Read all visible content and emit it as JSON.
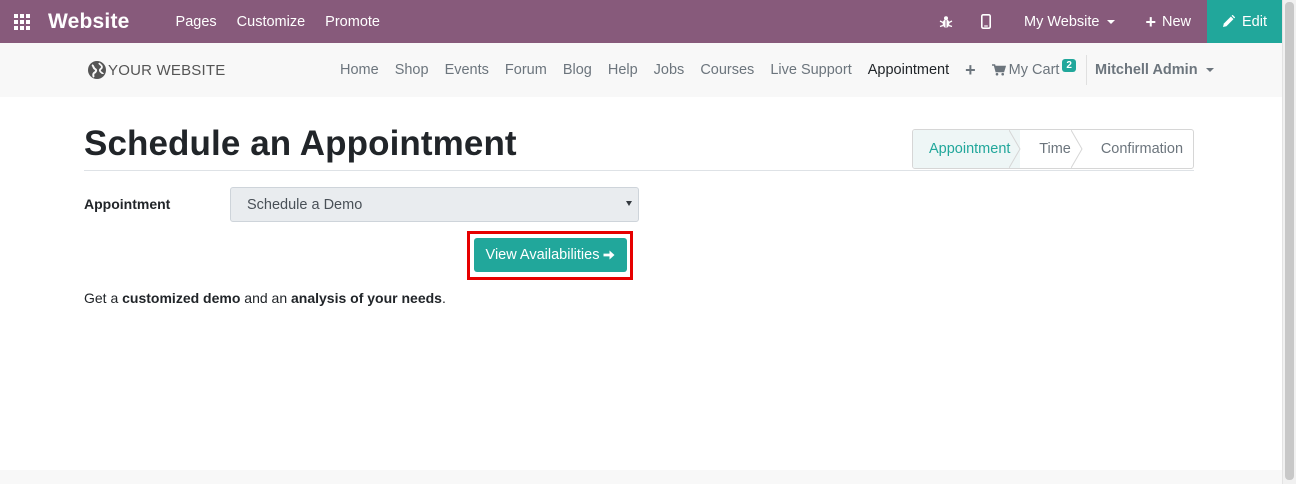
{
  "topbar": {
    "brand": "Website",
    "menu": [
      "Pages",
      "Customize",
      "Promote"
    ],
    "site_selector": "My Website",
    "new_label": "New",
    "edit_label": "Edit"
  },
  "navbar": {
    "logo": "YOUR WEBSITE",
    "links": [
      "Home",
      "Shop",
      "Events",
      "Forum",
      "Blog",
      "Help",
      "Jobs",
      "Courses",
      "Live Support",
      "Appointment"
    ],
    "active_link": "Appointment",
    "cart_label": "My Cart",
    "cart_count": "2",
    "user": "Mitchell Admin"
  },
  "main": {
    "title": "Schedule an Appointment",
    "steps": [
      "Appointment",
      "Time",
      "Confirmation"
    ],
    "active_step": "Appointment",
    "field_label": "Appointment",
    "selected_appointment": "Schedule a Demo",
    "button_label": "View Availabilities",
    "description": {
      "p1": "Get a ",
      "b1": "customized demo",
      "p2": " and an ",
      "b2": "analysis of your needs",
      "p3": "."
    }
  },
  "icons": {
    "apps": "apps-grid-icon",
    "bug": "bug-icon",
    "mobile": "mobile-icon",
    "plus": "plus-icon",
    "pencil": "pencil-icon",
    "cart": "shopping-cart-icon",
    "globe": "globe-icon",
    "arrow": "arrow-right-icon"
  },
  "colors": {
    "topbar": "#875a7b",
    "accent": "#21a79b",
    "highlight": "#e60000"
  }
}
